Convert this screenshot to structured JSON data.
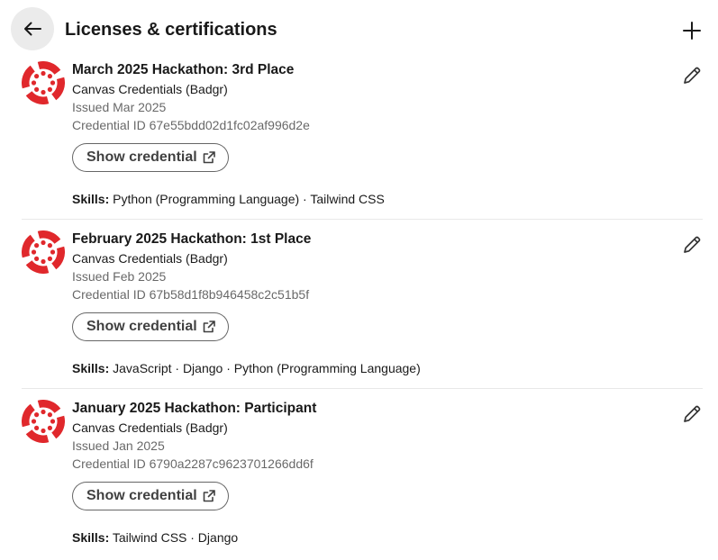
{
  "header": {
    "title": "Licenses & certifications",
    "back_icon": "arrow-left-icon",
    "add_icon": "plus-icon"
  },
  "colors": {
    "logo_red": "#e0282c",
    "divider": "#e8e8e8"
  },
  "certifications": [
    {
      "title": "March 2025 Hackathon: 3rd Place",
      "issuer": "Canvas Credentials (Badgr)",
      "issued": "Issued Mar 2025",
      "credential_id": "Credential ID 67e55bdd02d1fc02af996d2e",
      "button_label": "Show credential",
      "skills_label": "Skills:",
      "skills": "Python (Programming Language) · Tailwind CSS"
    },
    {
      "title": "February 2025 Hackathon: 1st Place",
      "issuer": "Canvas Credentials (Badgr)",
      "issued": "Issued Feb 2025",
      "credential_id": "Credential ID 67b58d1f8b946458c2c51b5f",
      "button_label": "Show credential",
      "skills_label": "Skills:",
      "skills": "JavaScript · Django · Python (Programming Language)"
    },
    {
      "title": "January 2025 Hackathon: Participant",
      "issuer": "Canvas Credentials (Badgr)",
      "issued": "Issued Jan 2025",
      "credential_id": "Credential ID 6790a2287c9623701266dd6f",
      "button_label": "Show credential",
      "skills_label": "Skills:",
      "skills": "Tailwind CSS · Django"
    }
  ]
}
